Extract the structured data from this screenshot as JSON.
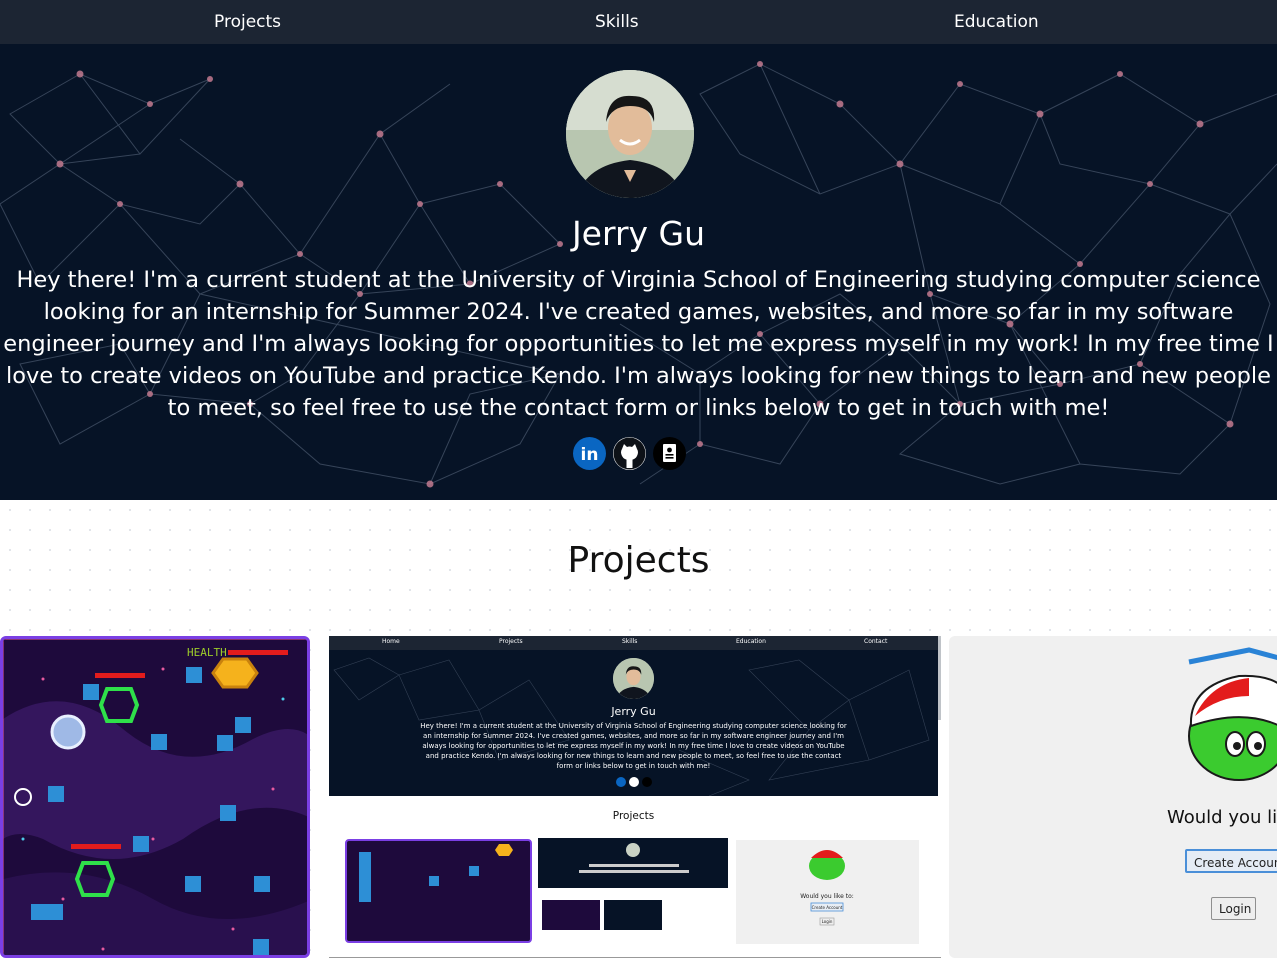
{
  "nav": {
    "items": [
      "Projects",
      "Skills",
      "Education"
    ]
  },
  "hero": {
    "name": "Jerry Gu",
    "bio": "Hey there! I'm a current student at the University of Virginia School of Engineering studying computer science looking for an internship for Summer 2024. I've created games, websites, and more so far in my software engineer journey and I'm always looking for opportunities to let me express myself in my work! In my free time I love to create videos on YouTube and practice Kendo. I'm always looking for new things to learn and new people to meet, so feel free to use the contact form or links below to get in touch with me!",
    "socials": [
      {
        "icon": "linkedin-icon",
        "color": "#0a66c2"
      },
      {
        "icon": "github-icon",
        "color": "#0d1117"
      },
      {
        "icon": "resume-icon",
        "color": "#000000"
      }
    ]
  },
  "projects": {
    "title": "Projects",
    "game_card": {
      "health_label": "HEALTH"
    },
    "site_card": {
      "nav": [
        "Home",
        "Projects",
        "Skills",
        "Education",
        "Contact"
      ],
      "name": "Jerry Gu",
      "bio": "Hey there! I'm a current student at the University of Virginia School of Engineering studying computer science looking for an internship for Summer 2024. I've created games, websites, and more so far in my software engineer journey and I'm always looking for opportunities to let me express myself in my work! In my free time I love to create videos on YouTube and practice Kendo. I'm always looking for new things to learn and new people to meet, so feel free to use the contact form or links below to get in touch with me!",
      "projects_title": "Projects",
      "inner_prompt": "Would you like to:",
      "inner_create": "Create Account",
      "inner_login": "Login"
    },
    "cp_card": {
      "prompt": "Would you lik",
      "create_button": "Create Account",
      "login_button": "Login"
    }
  },
  "colors": {
    "nav_bg": "#1c2533",
    "hero_bg": "#061326",
    "accent_purple": "#7b3fe4",
    "puffle_green": "#3bcb2f"
  }
}
